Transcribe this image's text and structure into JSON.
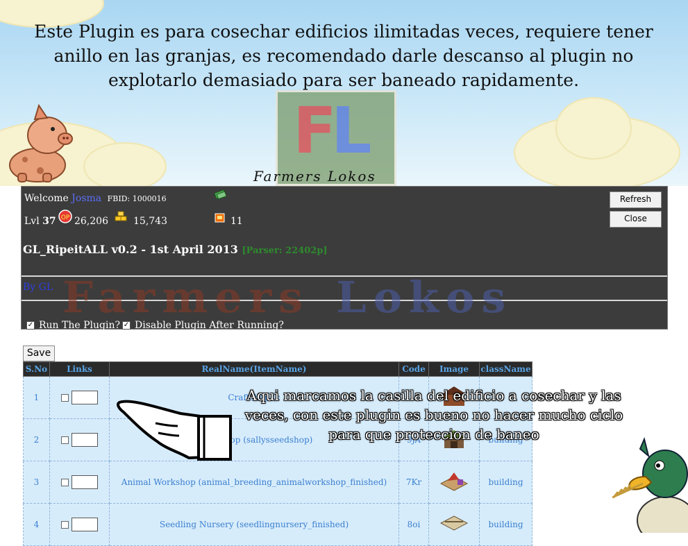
{
  "banner": {
    "text_line1": "Este Plugin es para  cosechar edificios ilimitadas veces, requiere tener",
    "text_line2": "anillo en las  granjas, es recomendado darle descanso al plugin no",
    "text_line3": "explotarlo demasiado para ser baneado rapidamente.",
    "logo_text_a": "F",
    "logo_text_b": "L",
    "script_label": "Farmers Lokos"
  },
  "header": {
    "welcome_label": "Welcome",
    "user_name": "Josma",
    "fbid_label": "FBID: 1000016",
    "lvl_label": "Lvl",
    "lvl_value": "37",
    "coins": "26,206",
    "cash": "15,743",
    "fuel": "11"
  },
  "plugin": {
    "title": "GL_RipeitALL v0.2 - 1st April 2013",
    "parser": "[Parser: 22402p]",
    "by": "By GL",
    "watermark_a": "Farmers",
    "watermark_b": "Lokos"
  },
  "buttons": {
    "refresh": "Refresh",
    "close": "Close",
    "save": "Save"
  },
  "options": {
    "run_label": "Run The Plugin?",
    "disable_label": "Disable Plugin After Running?"
  },
  "table": {
    "headers": [
      "S.No",
      "Links",
      "RealName(ItemName)",
      "Code",
      "Image",
      "className"
    ],
    "rows": [
      {
        "sno": "1",
        "name": "Craftshop (c",
        "code": "",
        "class": ""
      },
      {
        "sno": "2",
        "name": "Seed Shop (sallysseedshop)",
        "code": "9jA",
        "class": "building"
      },
      {
        "sno": "3",
        "name": "Animal Workshop (animal_breeding_animalworkshop_finished)",
        "code": "7Kr",
        "class": "building"
      },
      {
        "sno": "4",
        "name": "Seedling Nursery (seedlingnursery_finished)",
        "code": "8oi",
        "class": "building"
      }
    ]
  },
  "annotation": {
    "line1": "Aqui marcamos la  casilla del edificio a  cosechar y las",
    "line2": "veces, con este plugin es bueno no hacer mucho ciclo",
    "line3": "para que proteccion de baneo"
  },
  "colors": {
    "panel_bg": "#3c3c3c",
    "link_blue": "#5b6ef7",
    "parser_green": "#2e8b2e",
    "table_header_text": "#59a4e6",
    "table_row_bg": "#d7ecfb"
  }
}
